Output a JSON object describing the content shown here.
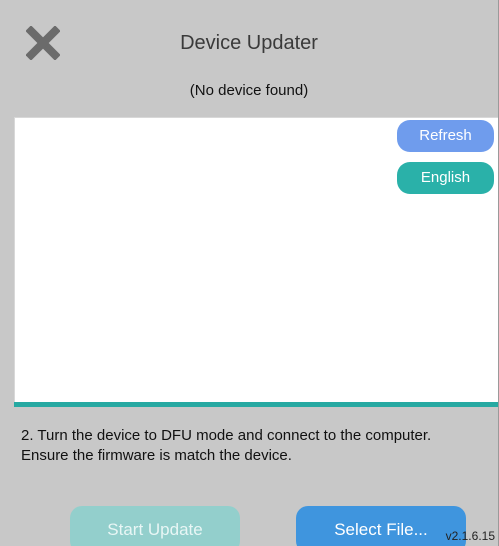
{
  "header": {
    "close_icon": "close-icon",
    "title": "Device Updater",
    "status": "(No device found)"
  },
  "panel": {
    "refresh_label": "Refresh",
    "language_label": "English"
  },
  "instructions": {
    "line1": "2. Turn the device to DFU mode and connect to the computer.",
    "line2": "Ensure the firmware is match the device."
  },
  "actions": {
    "start_update_label": "Start Update",
    "select_file_label": "Select File..."
  },
  "footer": {
    "version": "v2.1.6.15"
  },
  "colors": {
    "background": "#c8c8c8",
    "refresh": "#6f9ced",
    "language": "#2ab1a9",
    "accent_bar": "#26a9a2",
    "start_update_disabled": "#93cfcc",
    "select_file": "#3f95de"
  }
}
